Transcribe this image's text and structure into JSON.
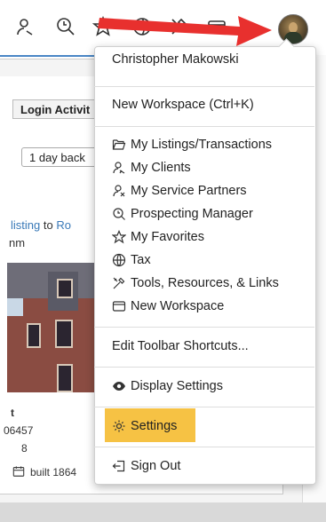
{
  "user": {
    "name": "Christopher Makowski"
  },
  "menu": {
    "new_workspace_shortcut": "New Workspace (Ctrl+K)",
    "items": [
      {
        "label": "My Listings/Transactions",
        "icon": "folder-open-icon"
      },
      {
        "label": "My Clients",
        "icon": "clients-icon"
      },
      {
        "label": "My Service Partners",
        "icon": "service-partners-icon"
      },
      {
        "label": "Prospecting Manager",
        "icon": "prospecting-search-icon"
      },
      {
        "label": "My Favorites",
        "icon": "star-icon"
      },
      {
        "label": "Tax",
        "icon": "tax-globe-icon"
      },
      {
        "label": "Tools, Resources, & Links",
        "icon": "tools-icon"
      },
      {
        "label": "New Workspace",
        "icon": "workspace-window-icon"
      }
    ],
    "edit_toolbar": "Edit Toolbar Shortcuts...",
    "display_settings": "Display Settings",
    "settings": "Settings",
    "sign_out": "Sign Out"
  },
  "background": {
    "login_activity": "Login Activit",
    "day_back": "1 day back",
    "listing_prefix": "",
    "listing_link": "listing",
    "listing_mid": " to ",
    "listing_link2": "Ro",
    "nm": "nm",
    "stat_t": "t",
    "stat_id": "06457",
    "stat_8": "8",
    "built": "built 1864"
  },
  "colors": {
    "highlight": "#f6c244",
    "arrow": "#e8302e",
    "link": "#3a7ab8",
    "accent_rule": "#4a86c5"
  }
}
